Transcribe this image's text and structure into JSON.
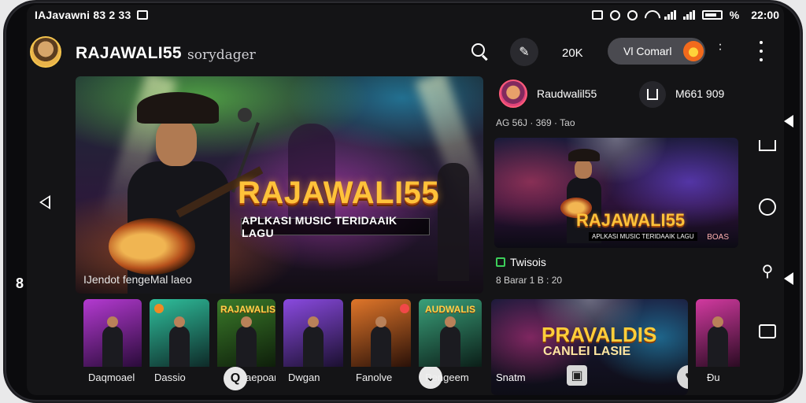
{
  "status_bar": {
    "carrier_text": "IAJavawni 83 2 33",
    "time": "22:00",
    "battery_text": "%"
  },
  "header": {
    "brand": "RAJAWALI55",
    "subtitle": "sorydager",
    "count": "20K",
    "pill_label": "Vl Comarl"
  },
  "hero": {
    "title": "RAJAWALI55",
    "strip": "APLKASI MUSIC TERIDAAIK LAGU",
    "caption": "IJendot fengeMal laeo"
  },
  "side_panel": {
    "channel_name": "Raudwalil55",
    "stat": "M661 909",
    "meta": "AG 56J · 369 · Tao",
    "thumb_title": "RAJAWALI55",
    "thumb_sub": "APLKASI MUSIC TERIDAAIK LAGU",
    "thumb_corner": "BOAS",
    "category": "Twisois",
    "time": "8 Barar 1 B : 20"
  },
  "tiles": [
    {
      "label": "Daqmoael",
      "art_text": "",
      "color_a": "#b43ad1",
      "color_b": "#2a0b3a",
      "badge": ""
    },
    {
      "label": "Dassio",
      "art_text": "",
      "color_a": "#2fbf9c",
      "color_b": "#0e2a28",
      "badge": "#f08a24"
    },
    {
      "label": "aepoan",
      "art_text": "RAJAWALIS",
      "color_a": "#3a7a2a",
      "color_b": "#0e1e0a",
      "badge": ""
    },
    {
      "label": "Dwgan",
      "art_text": "",
      "color_a": "#8a4ae0",
      "color_b": "#1b1030",
      "badge": ""
    },
    {
      "label": "Fanolve",
      "art_text": "",
      "color_a": "#e0762a",
      "color_b": "#2a1108",
      "badge": "#f04848"
    },
    {
      "label": "Pengeem",
      "art_text": "AUDWALIS",
      "color_a": "#3aa07a",
      "color_b": "#0b1e18",
      "badge": ""
    }
  ],
  "big_tile": {
    "title": "PRAVALDIS",
    "subtitle": "CANLEI LASIE",
    "label": "Snatm"
  },
  "last_tile": {
    "label": "Ðu",
    "color_a": "#d23aa0",
    "color_b": "#2a0b22"
  },
  "icons": {
    "search": "search-icon",
    "pen": "pen-icon",
    "more": "more-vert-icon",
    "home": "home-icon",
    "chat": "chat-bubble-icon",
    "link": "link-icon",
    "message": "message-icon"
  }
}
